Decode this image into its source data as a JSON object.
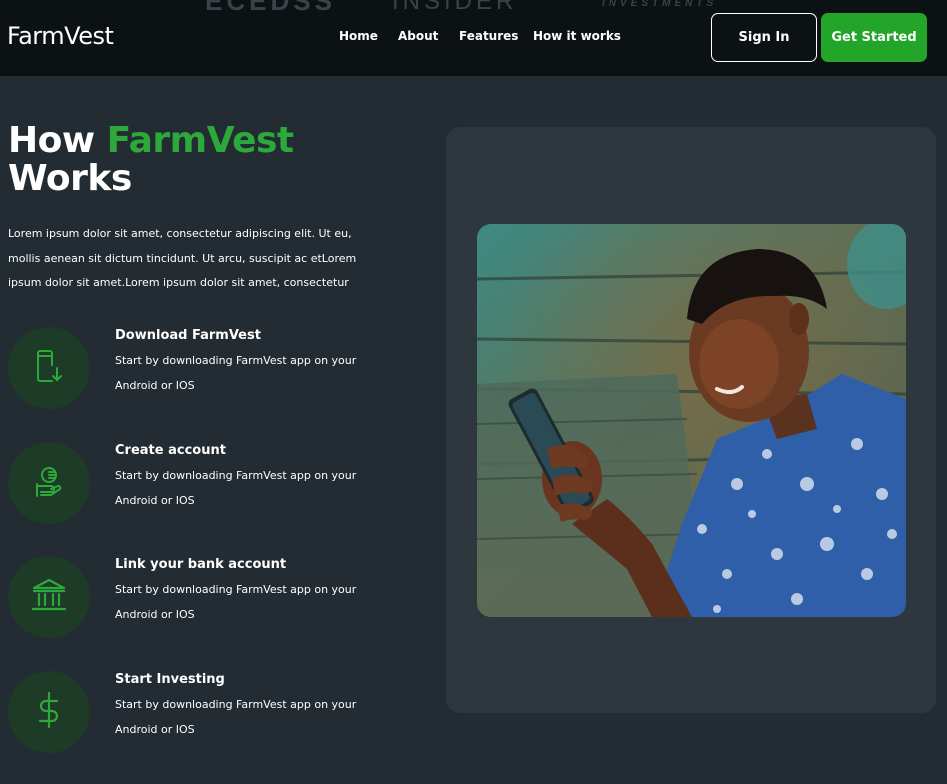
{
  "header": {
    "brand": "FarmVest",
    "ghost_logos": [
      "ECEDSS",
      "INSIDER",
      "INVESTMENTS"
    ],
    "nav": [
      {
        "label": "Home"
      },
      {
        "label": "About"
      },
      {
        "label": "Features"
      },
      {
        "label": "How it works"
      }
    ],
    "signin_label": "Sign In",
    "get_started_label": "Get Started"
  },
  "hero": {
    "heading_prefix": "How ",
    "heading_accent": "FarmVest",
    "heading_suffix": "Works",
    "intro": "Lorem ipsum dolor sit amet, consectetur adipiscing elit. Ut eu, mollis aenean sit dictum tincidunt. Ut arcu, suscipit ac etLorem ipsum dolor sit amet.Lorem ipsum dolor sit amet, consectetur"
  },
  "steps": [
    {
      "title": "Download FarmVest",
      "desc": "Start by downloading FarmVest app on your Android or IOS",
      "icon": "phone-download-icon"
    },
    {
      "title": "Create account",
      "desc": "Start by downloading FarmVest app on your Android or IOS",
      "icon": "coin-hand-icon"
    },
    {
      "title": "Link your bank account",
      "desc": "Start by downloading FarmVest app on your Android or IOS",
      "icon": "bank-icon"
    },
    {
      "title": "Start Investing",
      "desc": "Start by downloading FarmVest app on your Android or IOS",
      "icon": "dollar-icon"
    }
  ],
  "colors": {
    "accent": "#2ca93a",
    "button_green": "#23a52a",
    "background": "#232c32",
    "header_bg": "#0c1114",
    "panel_bg": "#2d373d",
    "icon_circle": "#1e3b27"
  },
  "image": {
    "subject": "man-using-smartphone-photo"
  }
}
